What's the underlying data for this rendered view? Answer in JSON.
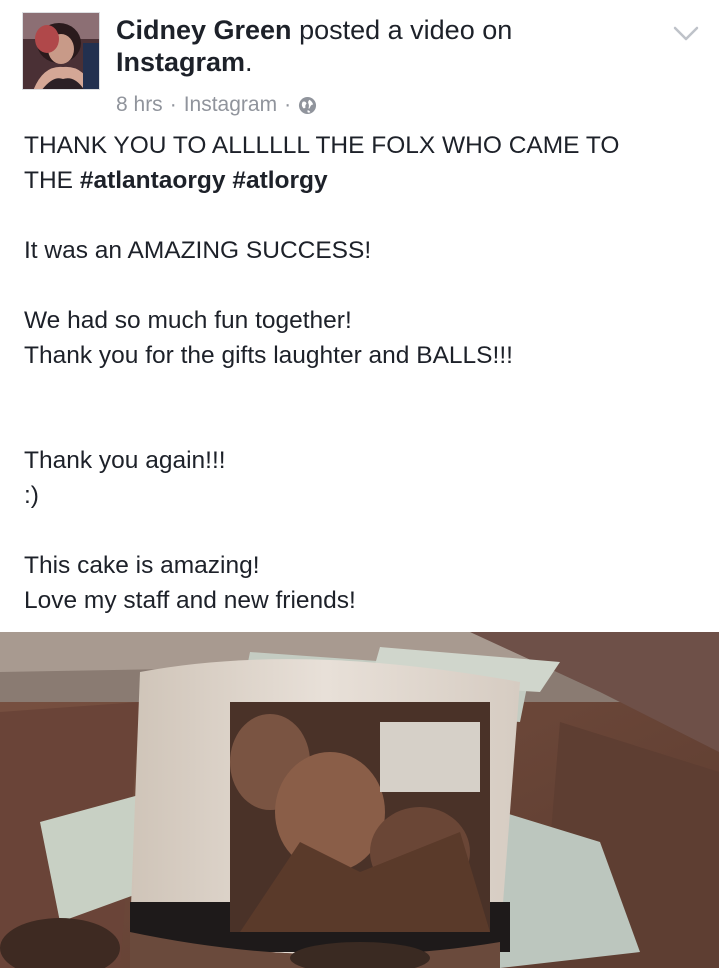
{
  "post": {
    "author": "Cidney Green",
    "action_text": "posted a video on",
    "app_name": "Instagram",
    "period": ".",
    "timestamp": "8 hrs",
    "source": "Instagram",
    "separator": "·",
    "privacy_icon": "globe-icon",
    "menu_icon": "chevron-down-icon",
    "text": {
      "line1": "THANK YOU TO ALLLLLL THE FOLX WHO CAME TO",
      "line2_prefix": "THE ",
      "hashtag1": "#atlantaorgy",
      "hashtag2": "#atlorgy",
      "para2": "It was an AMAZING SUCCESS!",
      "para3_line1": "We had so much fun together!",
      "para3_line2": "Thank you for the gifts laughter and BALLS!!!",
      "para4_line1": "Thank you again!!!",
      "para4_line2": ":)",
      "para5_line1": "This cake is amazing!",
      "para5_line2": "Love my staff and new friends!"
    }
  },
  "colors": {
    "text": "#1d2129",
    "meta": "#90949c",
    "background": "#ffffff"
  }
}
